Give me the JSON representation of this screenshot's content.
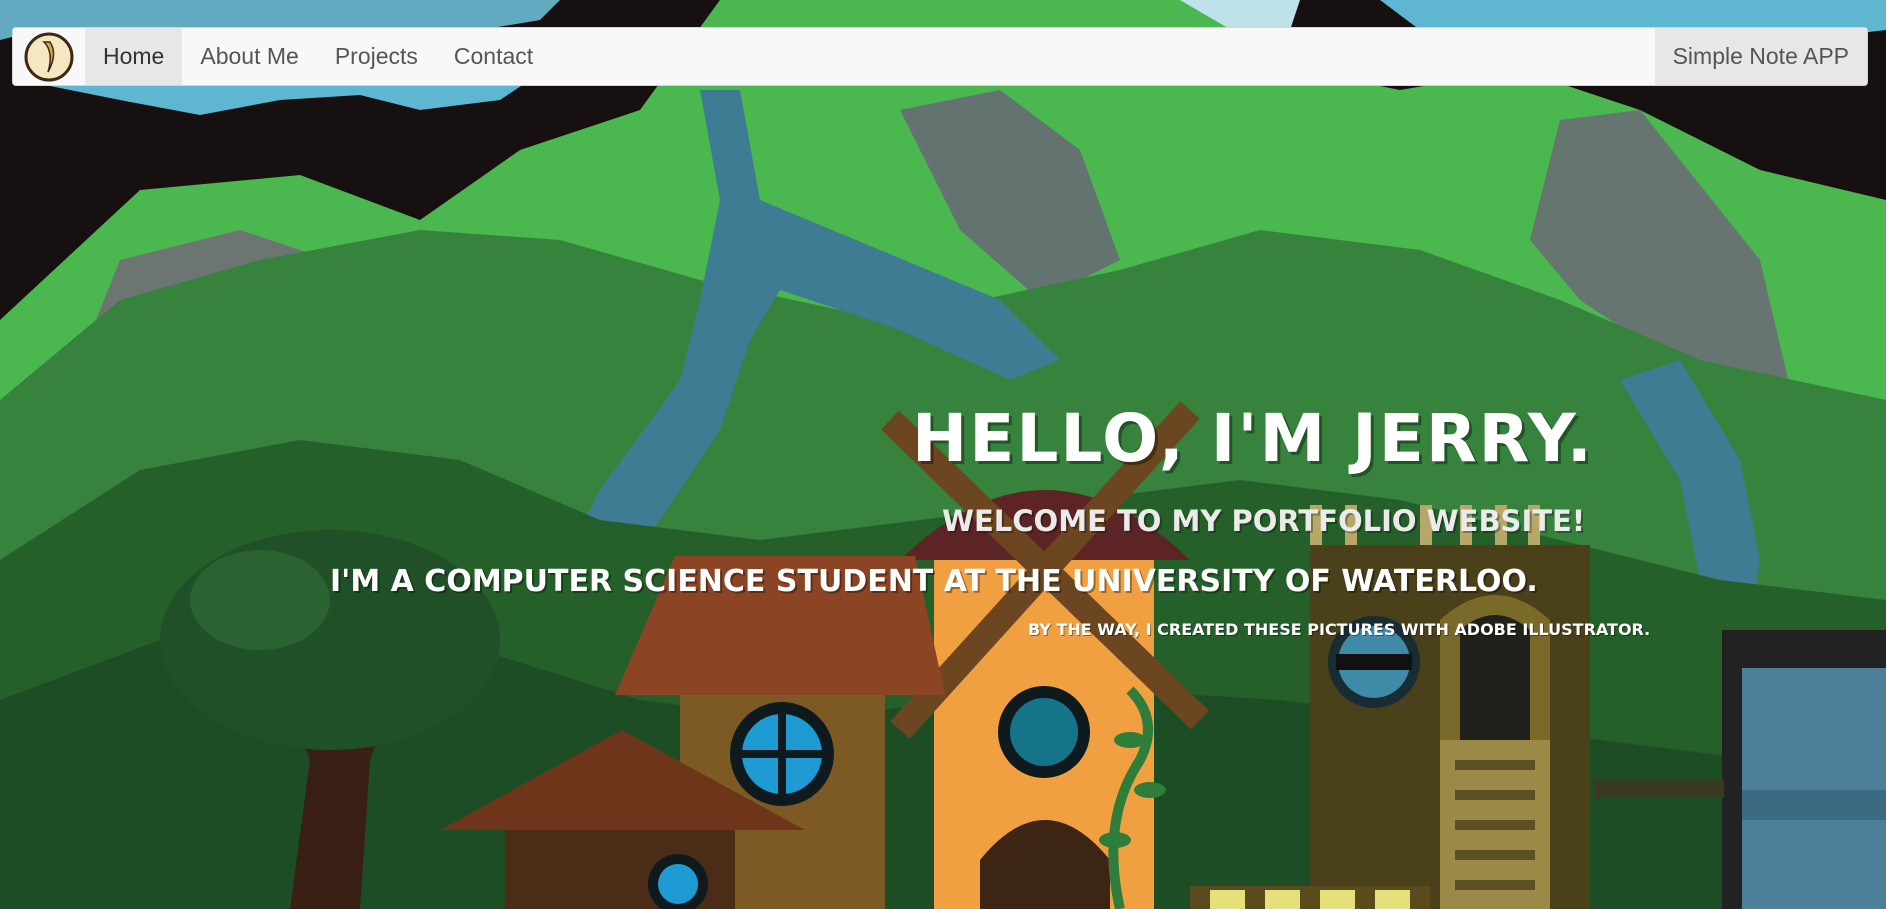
{
  "nav": {
    "logo_icon": "banana-logo-icon",
    "items": [
      {
        "label": "Home",
        "active": true
      },
      {
        "label": "About Me",
        "active": false
      },
      {
        "label": "Projects",
        "active": false
      },
      {
        "label": "Contact",
        "active": false
      }
    ],
    "right_label": "Simple Note APP"
  },
  "hero": {
    "title": "Hello, I'm Jerry.",
    "welcome": "Welcome to my portfolio website!",
    "intro": "I'm a computer science student at the University of Waterloo.",
    "note": "By the way, I created these pictures with Adobe Illustrator."
  },
  "colors": {
    "navbar_bg": "#f8f8f8",
    "nav_active_bg": "#e7e7e7",
    "nav_text": "#555555",
    "sky_dark": "#161010",
    "grass_light": "#4fb74f",
    "grass_dark": "#2d6b33",
    "river": "#3f7a8f"
  }
}
